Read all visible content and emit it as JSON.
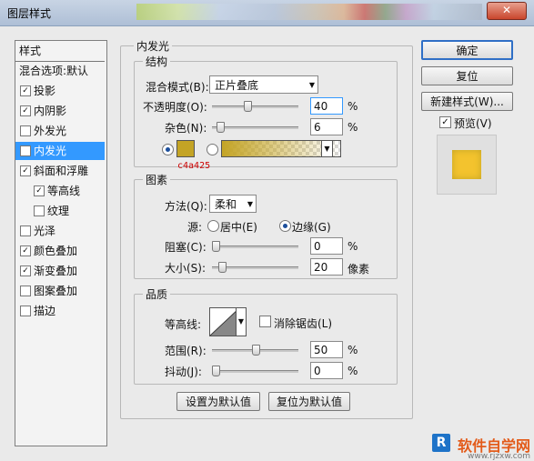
{
  "window": {
    "title": "图层样式",
    "close": "✕"
  },
  "left_panel": {
    "header": "样式",
    "items": [
      {
        "label": "混合选项:默认",
        "checkbox": false,
        "checked": false
      },
      {
        "label": "投影",
        "checkbox": true,
        "checked": true
      },
      {
        "label": "内阴影",
        "checkbox": true,
        "checked": true
      },
      {
        "label": "外发光",
        "checkbox": true,
        "checked": false
      },
      {
        "label": "内发光",
        "checkbox": true,
        "checked": true,
        "selected": true
      },
      {
        "label": "斜面和浮雕",
        "checkbox": true,
        "checked": true
      },
      {
        "label": "等高线",
        "checkbox": true,
        "checked": true,
        "indent": true
      },
      {
        "label": "纹理",
        "checkbox": true,
        "checked": false,
        "indent": true
      },
      {
        "label": "光泽",
        "checkbox": true,
        "checked": false
      },
      {
        "label": "颜色叠加",
        "checkbox": true,
        "checked": true
      },
      {
        "label": "渐变叠加",
        "checkbox": true,
        "checked": true
      },
      {
        "label": "图案叠加",
        "checkbox": true,
        "checked": false
      },
      {
        "label": "描边",
        "checkbox": true,
        "checked": false
      }
    ]
  },
  "panel": {
    "title": "内发光",
    "structure": {
      "title": "结构",
      "blend_mode_label": "混合模式(B):",
      "blend_mode_value": "正片叠底",
      "opacity_label": "不透明度(O):",
      "opacity_value": "40",
      "opacity_level": 0.4,
      "noise_label": "杂色(N):",
      "noise_value": "6",
      "noise_level": 0.06,
      "percent": "%",
      "color_hex": "#c4a425",
      "annotation": "c4a425"
    },
    "elements": {
      "title": "图素",
      "method_label": "方法(Q):",
      "method_value": "柔和",
      "source_label": "源:",
      "center_label": "居中(E)",
      "edge_label": "边缘(G)",
      "source_selected": "edge",
      "choke_label": "阻塞(C):",
      "choke_value": "0",
      "choke_level": 0.0,
      "size_label": "大小(S):",
      "size_value": "20",
      "size_unit": "像素",
      "size_level": 0.08,
      "percent": "%"
    },
    "quality": {
      "title": "品质",
      "contour_label": "等高线:",
      "antialias_label": "消除锯齿(L)",
      "antialias_checked": false,
      "range_label": "范围(R):",
      "range_value": "50",
      "range_level": 0.5,
      "jitter_label": "抖动(J):",
      "jitter_value": "0",
      "jitter_level": 0.0,
      "percent": "%"
    },
    "buttons": {
      "set_default": "设置为默认值",
      "reset_default": "复位为默认值"
    }
  },
  "right_buttons": {
    "ok": "确定",
    "reset": "复位",
    "new_style": "新建样式(W)...",
    "preview_label": "预览(V)",
    "preview_checked": true
  },
  "watermark": {
    "text": "软件自学网",
    "url": "www.rjzxw.com",
    "icon": "R"
  }
}
